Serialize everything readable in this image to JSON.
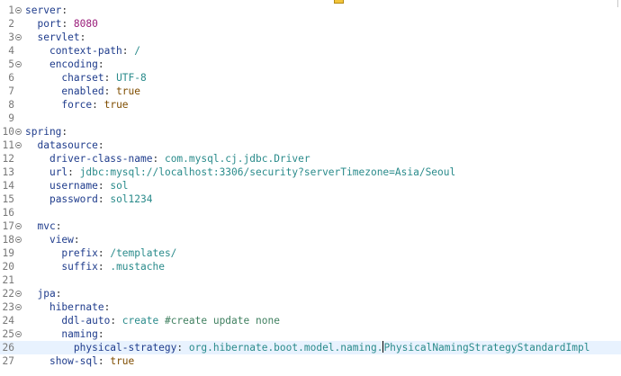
{
  "editor": {
    "top_marker_color": "#f2c43a",
    "lines": [
      {
        "n": "1",
        "fold": true,
        "key": "server",
        "sep": ":",
        "value": "",
        "vtype": ""
      },
      {
        "n": "2",
        "fold": false,
        "key": "port",
        "sep": ": ",
        "value": "8080",
        "vtype": "n"
      },
      {
        "n": "3",
        "fold": true,
        "key": "servlet",
        "sep": ":",
        "value": "",
        "vtype": ""
      },
      {
        "n": "4",
        "fold": false,
        "key": "context-path",
        "sep": ": ",
        "value": "/",
        "vtype": "s"
      },
      {
        "n": "5",
        "fold": true,
        "key": "encoding",
        "sep": ":",
        "value": "",
        "vtype": ""
      },
      {
        "n": "6",
        "fold": false,
        "key": "charset",
        "sep": ": ",
        "value": "UTF-8",
        "vtype": "s"
      },
      {
        "n": "7",
        "fold": false,
        "key": "enabled",
        "sep": ": ",
        "value": "true",
        "vtype": "b"
      },
      {
        "n": "8",
        "fold": false,
        "key": "force",
        "sep": ": ",
        "value": "true",
        "vtype": "b"
      },
      {
        "n": "9",
        "fold": false,
        "key": "",
        "sep": "",
        "value": "",
        "vtype": ""
      },
      {
        "n": "10",
        "fold": true,
        "key": "spring",
        "sep": ":",
        "value": "",
        "vtype": ""
      },
      {
        "n": "11",
        "fold": true,
        "key": "datasource",
        "sep": ":",
        "value": "",
        "vtype": ""
      },
      {
        "n": "12",
        "fold": false,
        "key": "driver-class-name",
        "sep": ": ",
        "value": "com.mysql.cj.jdbc.Driver",
        "vtype": "s"
      },
      {
        "n": "13",
        "fold": false,
        "key": "url",
        "sep": ": ",
        "value": "jdbc:mysql://localhost:3306/security?serverTimezone=Asia/Seoul",
        "vtype": "s"
      },
      {
        "n": "14",
        "fold": false,
        "key": "username",
        "sep": ": ",
        "value": "sol",
        "vtype": "s"
      },
      {
        "n": "15",
        "fold": false,
        "key": "password",
        "sep": ": ",
        "value": "sol1234",
        "vtype": "s"
      },
      {
        "n": "16",
        "fold": false,
        "key": "",
        "sep": "",
        "value": "",
        "vtype": ""
      },
      {
        "n": "17",
        "fold": true,
        "key": "mvc",
        "sep": ":",
        "value": "",
        "vtype": ""
      },
      {
        "n": "18",
        "fold": true,
        "key": "view",
        "sep": ":",
        "value": "",
        "vtype": ""
      },
      {
        "n": "19",
        "fold": false,
        "key": "prefix",
        "sep": ": ",
        "value": "/templates/",
        "vtype": "s"
      },
      {
        "n": "20",
        "fold": false,
        "key": "suffix",
        "sep": ": ",
        "value": ".mustache",
        "vtype": "s"
      },
      {
        "n": "21",
        "fold": false,
        "key": "",
        "sep": "",
        "value": "",
        "vtype": ""
      },
      {
        "n": "22",
        "fold": true,
        "key": "jpa",
        "sep": ":",
        "value": "",
        "vtype": ""
      },
      {
        "n": "23",
        "fold": true,
        "key": "hibernate",
        "sep": ":",
        "value": "",
        "vtype": ""
      },
      {
        "n": "24",
        "fold": false,
        "key": "ddl-auto",
        "sep": ": ",
        "value": "create ",
        "vtype": "s",
        "comment": "#create update none"
      },
      {
        "n": "25",
        "fold": true,
        "key": "naming",
        "sep": ":",
        "value": "",
        "vtype": ""
      },
      {
        "n": "26",
        "fold": false,
        "key": "physical-strategy",
        "sep": ": ",
        "value": "org.hibernate.boot.model.naming.PhysicalNamingStrategyStandardImpl",
        "vtype": "s",
        "current": true,
        "caret_at": 32
      },
      {
        "n": "27",
        "fold": false,
        "key": "show-sql",
        "sep": ": ",
        "value": "true",
        "vtype": "b"
      }
    ]
  }
}
